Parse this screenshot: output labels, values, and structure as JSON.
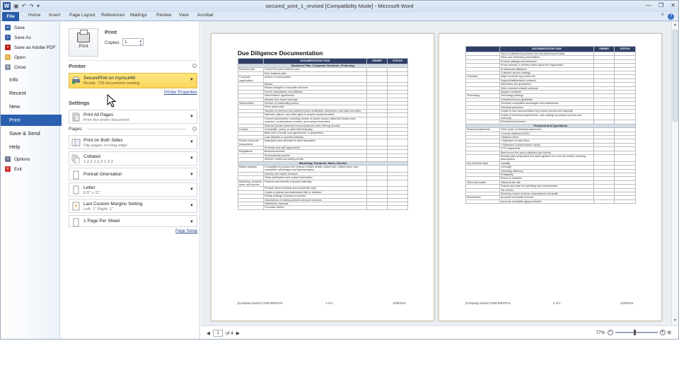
{
  "window": {
    "title": "secured_print_1_revised [Compatibility Mode]  -  Microsoft Word",
    "qat_icons": [
      "word-logo-icon",
      "save-icon",
      "undo-icon",
      "redo-icon",
      "customize-icon"
    ]
  },
  "ribbon": {
    "tabs": [
      "File",
      "Home",
      "Insert",
      "Page Layout",
      "References",
      "Mailings",
      "Review",
      "View",
      "Acrobat"
    ]
  },
  "backstage": {
    "small_items": [
      "Save",
      "Save As",
      "Save as Adobe PDF",
      "Open",
      "Close"
    ],
    "big_items": [
      "Info",
      "Recent",
      "New",
      "Print",
      "Save & Send",
      "Help"
    ],
    "bottom_items": [
      "Options",
      "Exit"
    ]
  },
  "print": {
    "heading": "Print",
    "copies_label": "Copies:",
    "copies_value": "1",
    "button_label": "Print",
    "printer_heading": "Printer",
    "printer_name": "SecurePrint on mynsut49",
    "printer_status": "Ready: 739 documents waiting",
    "printer_properties": "Printer Properties",
    "settings_heading": "Settings",
    "pages_label": "Pages:",
    "page_setup": "Page Setup",
    "settings": [
      {
        "l1": "Print All Pages",
        "l2": "Print the entire document"
      },
      {
        "l1": "Print on Both Sides",
        "l2": "Flip pages on long edge"
      },
      {
        "l1": "Collated",
        "l2": "1,2,3    1,2,3    1,2,3"
      },
      {
        "l1": "Portrait Orientation",
        "l2": ""
      },
      {
        "l1": "Letter",
        "l2": "8.5\" x 11\""
      },
      {
        "l1": "Last Custom Margins Setting",
        "l2": "Left: 1\"    Right: 1\""
      },
      {
        "l1": "1 Page Per Sheet",
        "l2": ""
      }
    ]
  },
  "preview": {
    "page_current": "1",
    "page_of": "of 4",
    "zoom": "77%",
    "page1": {
      "title": "Due Diligence Documentation",
      "headers": [
        "DOCUMENTATION TASK",
        "OWNER",
        "STATUS"
      ],
      "rows": [
        [
          "sec",
          "Business Plan, Corporate Structure, Financing"
        ],
        [
          "Business plan",
          "Current five-year business plan"
        ],
        [
          "",
          "Prior business plan"
        ],
        [
          "Corporate organization",
          "Articles of incorporation"
        ],
        [
          "",
          "Bylaws"
        ],
        [
          "",
          "Recent changes in corporate structure"
        ],
        [
          "",
          "Parent, subsidiaries, and affiliates"
        ],
        [
          "",
          "Shareholders' agreements"
        ],
        [
          "",
          "Minutes from board meetings"
        ],
        [
          "Shareholders",
          "Number of outstanding shares"
        ],
        [
          "",
          "Stock option plan"
        ],
        [
          "",
          "Samples of common and preferred stock certificates, debentures, and other securities"
        ],
        [
          "",
          "Warrants, options, and other rights to acquire equity securities"
        ],
        [
          "",
          "Current shareholders, including number of shares owned, dates that shares were acquired, considerations received, and contact information"
        ],
        [
          "",
          "Relevant private placement memoranda and other offering circulars"
        ],
        [
          "Lenders",
          "Convertible, senior, or other debt financing"
        ],
        [
          "",
          "Bank lines of credit, loan agreements, or guarantees"
        ],
        [
          "",
          "Loan defaults or expected defaults"
        ],
        [
          "Recent corporate transactions",
          "Description and rationale for each transaction"
        ],
        [
          "",
          "Purchase and sale agreements"
        ],
        [
          "Regulations",
          "Business licenses"
        ],
        [
          "",
          "Environmental permits"
        ],
        [
          "",
          "Workers' health and safety permits"
        ],
        [
          "sec",
          "Marketing, Products, Sales, Service"
        ],
        [
          "Market analysis",
          "Competition by product line (include contact details, market size, market share, and competitive advantages and disadvantages)"
        ],
        [
          "",
          "Industry and market research"
        ],
        [
          "",
          "Trade publications and contact information"
        ],
        [
          "Marketing, products, sales, and service",
          "Features and benefits of product offerings"
        ],
        [
          "",
          "Product rollout schedule and product life cycle"
        ],
        [
          "",
          "Copies of patents and trademarks filed or obtained"
        ],
        [
          "",
          "Pricing strategy of product or service"
        ],
        [
          "",
          "Descriptions of existing partners and joint ventures"
        ],
        [
          "",
          "Distribution channels"
        ],
        [
          "",
          "Promotion tactics"
        ]
      ],
      "footer": [
        "[Company Name] CONFIDENTIAL",
        "1 of 4",
        "12/8/2014"
      ]
    },
    "page2": {
      "headers": [
        "DOCUMENTATION TASK",
        "OWNER",
        "STATUS"
      ],
      "rows": [
        [
          "",
          "Top 10 customers by product line and total invoiced base"
        ],
        [
          "",
          "Sales and marketing presentations"
        ],
        [
          "",
          "Product catalogs and brochures"
        ],
        [
          "",
          "Press releases or articles written about the organization"
        ],
        [
          "",
          "Professional affiliations"
        ],
        [
          "",
          "Customer service strategy"
        ],
        [
          "Contracts",
          "Major contracts by product line"
        ],
        [
          "",
          "Support/maintenance contracts"
        ],
        [
          "",
          "Warranties and guarantees"
        ],
        [
          "",
          "Other customer-related contracts"
        ],
        [
          "",
          "Supplier contracts"
        ],
        [
          "Technology",
          "Technology strategy"
        ],
        [
          "",
          "Overall technical capabilities"
        ],
        [
          "",
          "Technical competitive advantages and weaknesses"
        ],
        [
          "",
          "Technical personnel"
        ],
        [
          "",
          "Copies of user documentation by product (current and historical)"
        ],
        [
          "",
          "Copies of technical requirements, code strategy by product (current and historical)"
        ],
        [
          "",
          "Development process"
        ],
        [
          "sec",
          "Financial and Operations"
        ],
        [
          "Financial statements",
          "Three years of historical statements:"
        ],
        [
          "",
          "•  Income statement (P&L)"
        ],
        [
          "",
          "•  Balance sheet"
        ],
        [
          "",
          "•  Statement of cash flows"
        ],
        [
          "",
          "•  Statement of shareholders' equity"
        ],
        [
          "",
          "LTTD statements"
        ],
        [
          "",
          "Most recent five-year projections (pro forma)"
        ],
        [
          "",
          "Monthly sales projections and sales pipeline over next 36 months, including assumptions"
        ],
        [
          "Key financial ratios",
          "Liquidity"
        ],
        [
          "",
          "Leverage"
        ],
        [
          "",
          "Operating efficiency"
        ],
        [
          "",
          "Profitability"
        ],
        [
          "",
          "Return to investors"
        ],
        [
          "Taxes and audits",
          "Historical tax rate"
        ],
        [
          "",
          "Federal and state net operating loss carryforwards"
        ],
        [
          "",
          "Tax returns"
        ],
        [
          "",
          "Summary results of all tax examinations and audits"
        ],
        [
          "Receivables",
          "Accounts receivable turnover"
        ],
        [
          "",
          "Accounts receivable aging schedule"
        ]
      ],
      "footer": [
        "[Company Name] CONFIDENTIAL",
        "2 of 4",
        "12/8/2014"
      ]
    }
  }
}
